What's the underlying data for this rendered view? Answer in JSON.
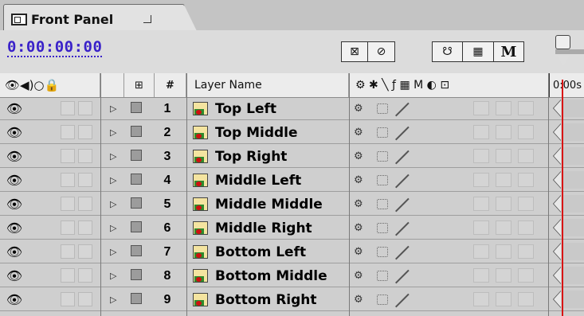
{
  "panel": {
    "tab_title": "Front Panel",
    "timecode": "0:00:00:00"
  },
  "toolbar": {
    "buttons": [
      "⊠",
      "⊘",
      "☋",
      "▦",
      "M"
    ]
  },
  "header": {
    "switches_glyphs": "👁◀)○🔒",
    "parent_glyph": "⊞",
    "number": "#",
    "layer_name": "Layer Name",
    "mode_glyphs": "⚙ ✱ ╲ ƒ ▦ M ◐ ⊡",
    "time_label": "0:00s"
  },
  "layers": [
    {
      "num": "1",
      "name": "Top Left"
    },
    {
      "num": "2",
      "name": "Top Middle"
    },
    {
      "num": "3",
      "name": "Top Right"
    },
    {
      "num": "4",
      "name": "Middle Left"
    },
    {
      "num": "5",
      "name": "Middle Middle"
    },
    {
      "num": "6",
      "name": "Middle Right"
    },
    {
      "num": "7",
      "name": "Bottom Left"
    },
    {
      "num": "8",
      "name": "Bottom Middle"
    },
    {
      "num": "9",
      "name": "Bottom Right"
    }
  ],
  "icons": {
    "eye": "eye-icon",
    "twirl": "twirl-arrow-icon",
    "layer": "footage-layer-icon",
    "quality": "quality-switch-icon"
  },
  "colors": {
    "timecode": "#3a22c9",
    "current_time_indicator": "#d81414"
  }
}
